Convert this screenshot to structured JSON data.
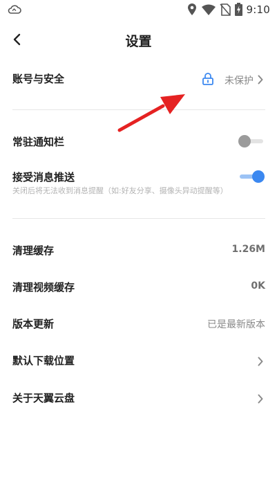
{
  "status_bar": {
    "time": "9:10",
    "icons": [
      "cloud-icon",
      "location-icon",
      "wifi-icon",
      "no-sim-icon",
      "battery-charging-icon"
    ]
  },
  "header": {
    "title": "设置",
    "back_icon": "chevron-left-icon"
  },
  "account_security": {
    "label": "账号与安全",
    "status": "未保护",
    "status_icon": "lock-icon",
    "accent": "#3b88f0"
  },
  "notifications": {
    "persistent_bar": {
      "label": "常驻通知栏",
      "enabled": false
    },
    "push": {
      "label": "接受消息推送",
      "description": "关闭后将无法收到消息提醒（如:好友分享、摄像头异动提醒等）",
      "enabled": true
    }
  },
  "storage": {
    "clear_cache": {
      "label": "清理缓存",
      "value": "1.26M"
    },
    "clear_video_cache": {
      "label": "清理视频缓存",
      "value": "0K"
    }
  },
  "about": {
    "version_update": {
      "label": "版本更新",
      "value": "已是最新版本"
    },
    "download_location": {
      "label": "默认下载位置"
    },
    "about_app": {
      "label": "关于天翼云盘"
    }
  },
  "annotation": {
    "color": "#e52222"
  }
}
